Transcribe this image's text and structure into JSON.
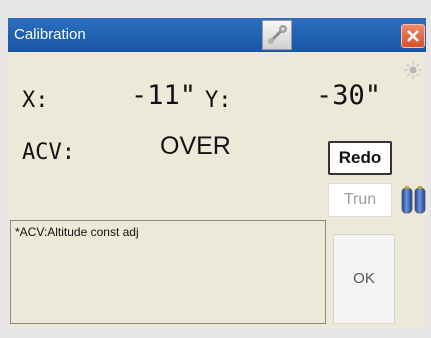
{
  "window": {
    "title": "Calibration"
  },
  "readouts": {
    "x_label": "X:",
    "x_value": "-11\"",
    "y_label": "Y:",
    "y_value": "-30\"",
    "acv_label": "ACV:",
    "acv_value": "OVER"
  },
  "buttons": {
    "redo": "Redo",
    "trun": "Trun",
    "ok": "OK"
  },
  "note": {
    "text": "*ACV:Altitude const adj"
  },
  "icons": {
    "title_icon": "connection-icon",
    "close": "close-icon",
    "status": "sun-icon",
    "battery": "battery-icon"
  },
  "colors": {
    "titlebar": "#2163b4",
    "close": "#d4502a",
    "window_bg": "#ece9d8",
    "disabled_text": "#9c9c9c"
  }
}
